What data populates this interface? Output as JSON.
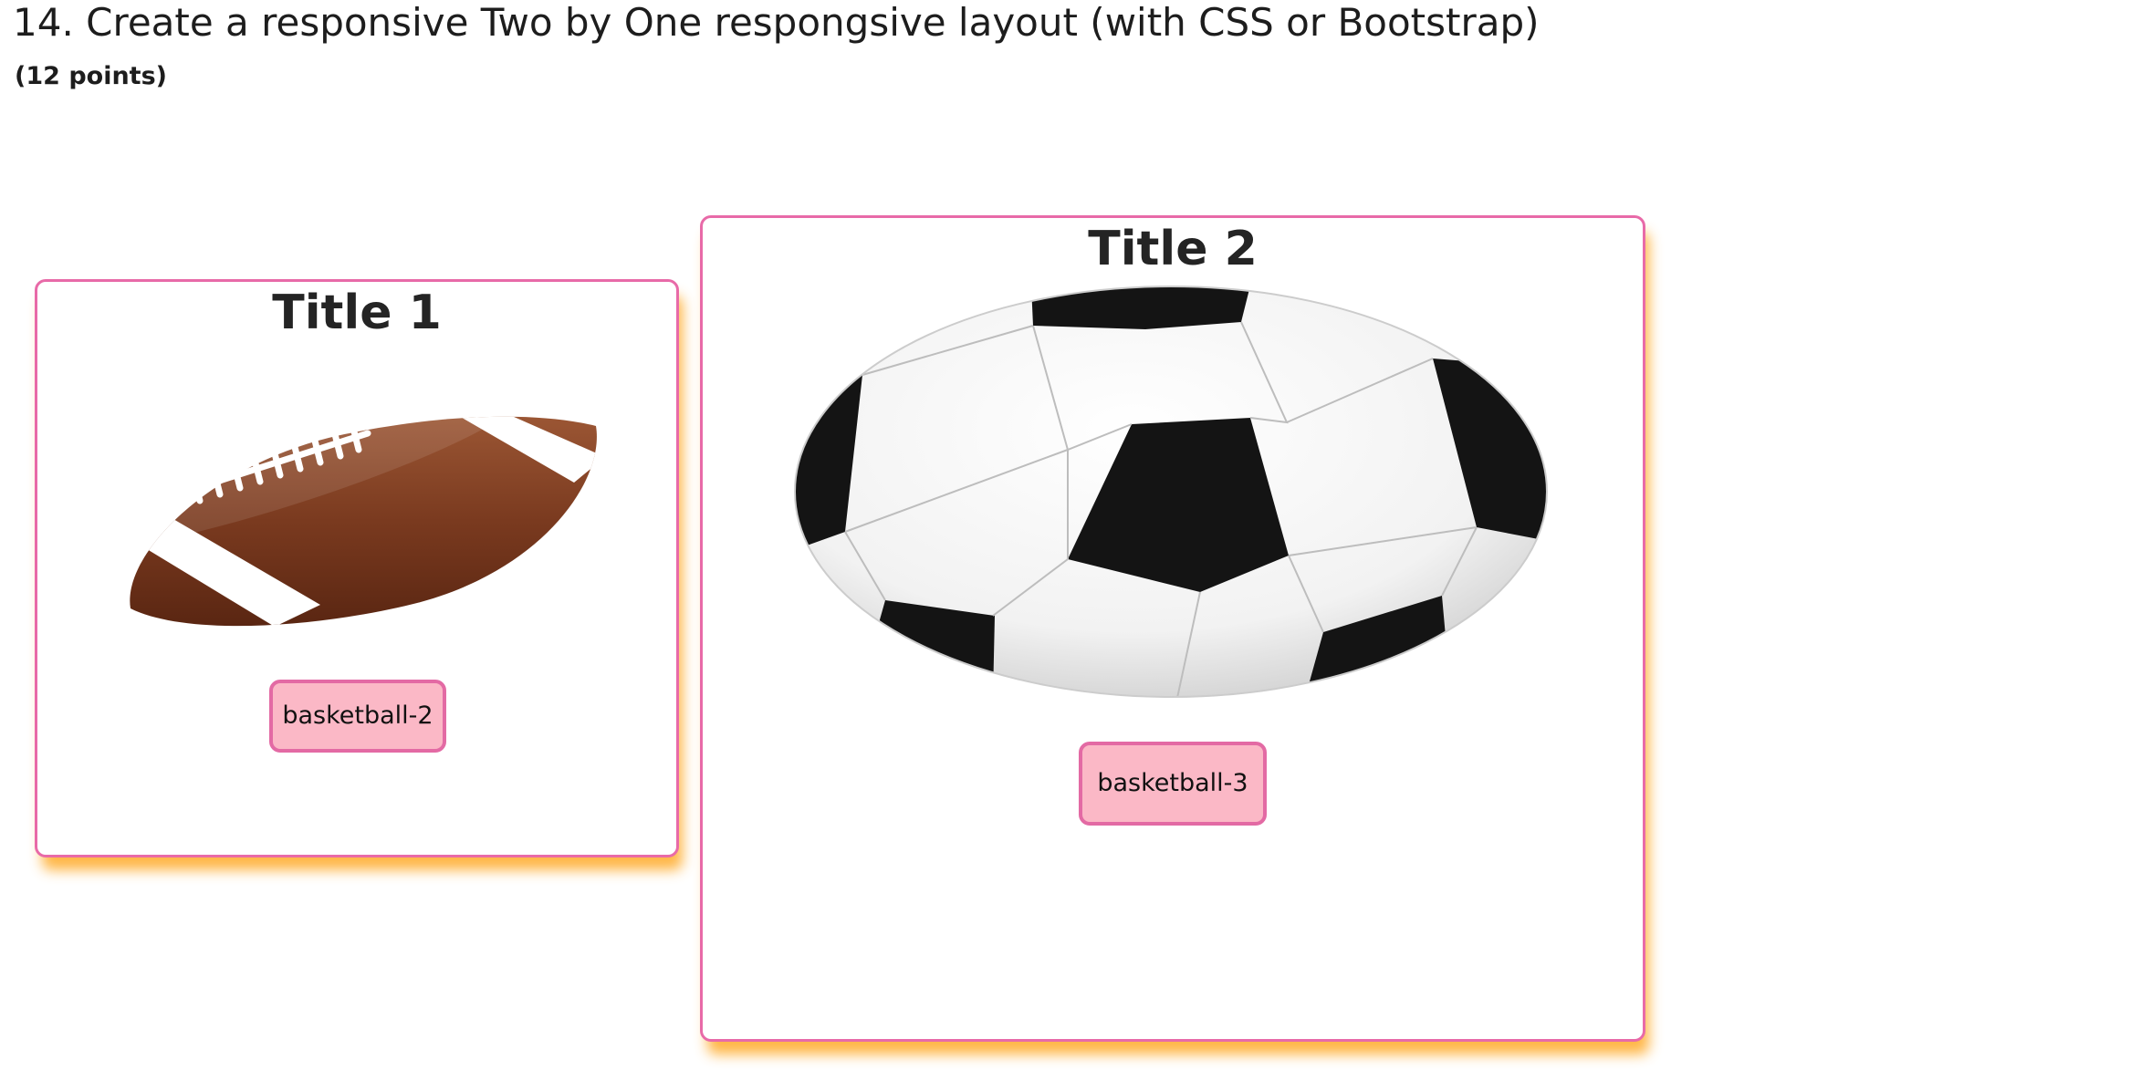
{
  "question": {
    "title": "14. Create a responsive Two by One respongsive layout (with CSS or Bootstrap)",
    "points": "(12 points)"
  },
  "cards": [
    {
      "title": "Title 1",
      "image_icon": "american-football-icon",
      "button_label": "basketball-2"
    },
    {
      "title": "Title 2",
      "image_icon": "soccer-ball-icon",
      "button_label": "basketball-3"
    }
  ],
  "colors": {
    "card_border": "#e86aa8",
    "card_shadow": "#ffaa28",
    "button_bg": "#fbb8c6",
    "button_border": "#e36aa4"
  }
}
